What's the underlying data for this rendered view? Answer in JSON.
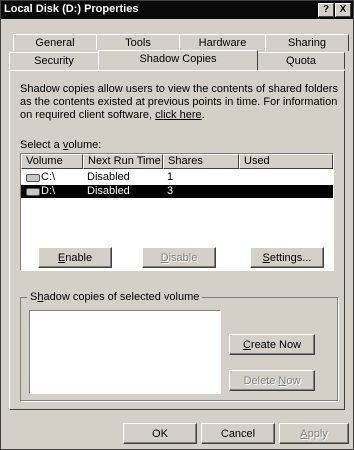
{
  "window": {
    "title": "Local Disk (D:) Properties",
    "help_label": "?",
    "close_label": "X"
  },
  "tabs": {
    "row1": [
      "General",
      "Tools",
      "Hardware",
      "Sharing"
    ],
    "row2": [
      "Security",
      "Shadow Copies",
      "Quota"
    ],
    "active": "Shadow Copies"
  },
  "description": {
    "text": "Shadow copies allow users to view the contents of shared folders as the contents existed at previous points in time. For information on required client software, ",
    "link": "click here",
    "end": "."
  },
  "volume_section": {
    "label_pre": "Select a ",
    "label_u": "v",
    "label_post": "olume:",
    "columns": [
      "Volume",
      "Next Run Time",
      "Shares",
      "Used"
    ],
    "rows": [
      {
        "volume": "C:\\",
        "next_run": "Disabled",
        "shares": "1",
        "used": "",
        "selected": false
      },
      {
        "volume": "D:\\",
        "next_run": "Disabled",
        "shares": "3",
        "used": "",
        "selected": true
      }
    ]
  },
  "buttons": {
    "enable_u": "E",
    "enable_rest": "nable",
    "disable_u": "D",
    "disable_rest": "isable",
    "settings_u": "S",
    "settings_rest": "ettings...",
    "create_u": "C",
    "create_rest": "reate Now",
    "delete_pre": "Delete ",
    "delete_u": "N",
    "delete_rest": "ow",
    "ok": "OK",
    "cancel": "Cancel",
    "apply_u": "A",
    "apply_rest": "pply"
  },
  "group": {
    "title_pre": "S",
    "title_u": "h",
    "title_post": "adow copies of selected volume"
  },
  "colors": {
    "face": "#d4d0c8",
    "titlebar": "#0a0a0a",
    "selection": "#000000"
  }
}
